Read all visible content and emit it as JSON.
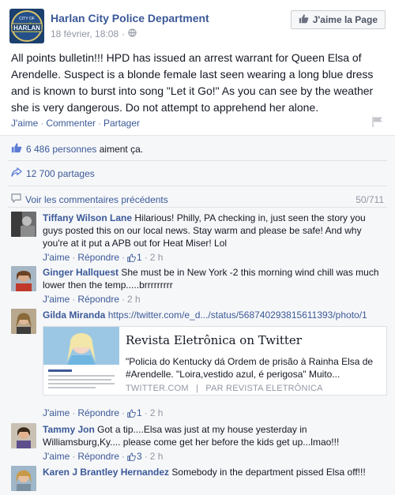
{
  "page": {
    "name": "Harlan City Police Department",
    "logo_text_top": "CITY OF",
    "logo_text_main": "HARLAN",
    "date": "18 février, 18:08",
    "like_page_label": "J'aime la Page"
  },
  "post": {
    "text": "All points bulletin!!! HPD has issued an arrest warrant for Queen Elsa of Arendelle. Suspect is a blonde female last seen wearing a long blue dress and is known to burst into song \"Let it Go!\" As you can see by the weather she is very dangerous. Do not attempt to apprehend her alone.",
    "actions": {
      "like": "J'aime",
      "comment": "Commenter",
      "share": "Partager"
    }
  },
  "stats": {
    "likes": "6 486 personnes",
    "likes_suffix": "aiment ça.",
    "shares": "12 700 partages",
    "see_previous": "Voir les commentaires précédents",
    "counter": "50/711"
  },
  "comment_actions": {
    "like": "J'aime",
    "reply": "Répondre"
  },
  "comments": [
    {
      "author": "Tiffany Wilson Lane",
      "text": "Hilarious! Philly, PA checking in, just seen the story you guys posted this on our local news. Stay warm and please be safe! And why you're at it put a APB out for Heat Miser! Lol",
      "likes": "1",
      "time": "2 h"
    },
    {
      "author": "Ginger Hallquest",
      "text": "She must be in New York -2 this morning wind chill was much lower then the temp.....brrrrrrrrr",
      "time": "2 h"
    },
    {
      "author": "Gilda Miranda",
      "text": "https://twitter.com/e_d.../status/568740293815611393/photo/1",
      "likes": "1",
      "time": "2 h",
      "card": {
        "title": "Revista Eletrônica on Twitter",
        "desc": "\"Policia do Kentucky dá Ordem de prisão à Rainha Elsa de #Arendelle. \"Loira,vestido azul, é perigosa\" Muito...",
        "source": "TWITTER.COM",
        "by": "PAR REVISTA ELETRÔNICA"
      }
    },
    {
      "author": "Tammy Jon",
      "text": "Got a tip....Elsa was just at my house yesterday in Williamsburg,Ky.... please come get her before the kids get up...lmao!!!",
      "likes": "3",
      "time": "2 h"
    },
    {
      "author": "Karen J Brantley Hernandez",
      "text": "Somebody in the department pissed Elsa off!!!"
    }
  ]
}
